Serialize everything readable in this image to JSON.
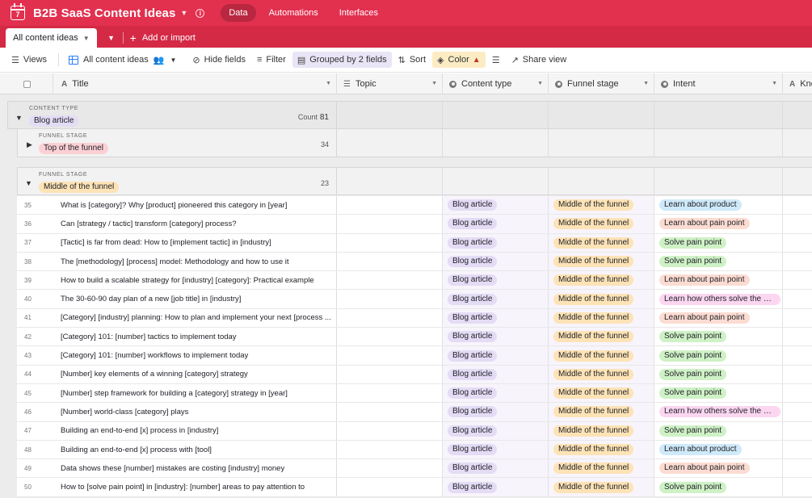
{
  "app": {
    "title": "B2B SaaS Content Ideas",
    "calendar_day": "7",
    "nav": [
      "Data",
      "Automations",
      "Interfaces"
    ],
    "accent": "#e2304f"
  },
  "tabs": {
    "active": "All content ideas",
    "add_import": "Add or import"
  },
  "toolbar": {
    "views": "Views",
    "view_name": "All content ideas",
    "hide_fields": "Hide fields",
    "filter": "Filter",
    "grouped": "Grouped by 2 fields",
    "sort": "Sort",
    "color": "Color",
    "share": "Share view"
  },
  "columns": [
    "Title",
    "Topic",
    "Content type",
    "Funnel stage",
    "Intent",
    "Kno"
  ],
  "groups": {
    "level1_label": "CONTENT TYPE",
    "level1_value": "Blog article",
    "level1_count_label": "Count",
    "level1_count": "81",
    "level2_label": "FUNNEL STAGE",
    "top_value": "Top of the funnel",
    "top_count": "34",
    "middle_value": "Middle of the funnel",
    "middle_count": "23"
  },
  "rows": [
    {
      "n": "35",
      "title": "What is [category]? Why [product] pioneered this category in [year]",
      "type": "Blog article",
      "stage": "Middle of the funnel",
      "intent": "Learn about product",
      "ik": "lprod"
    },
    {
      "n": "36",
      "title": "Can [strategy / tactic] transform [category] process?",
      "type": "Blog article",
      "stage": "Middle of the funnel",
      "intent": "Learn about pain point",
      "ik": "lpain"
    },
    {
      "n": "37",
      "title": "[Tactic] is far from dead: How to [implement tactic] in [industry]",
      "type": "Blog article",
      "stage": "Middle of the funnel",
      "intent": "Solve pain point",
      "ik": "solve"
    },
    {
      "n": "38",
      "title": "The [methodology] [process] model: Methodology and how to use it",
      "type": "Blog article",
      "stage": "Middle of the funnel",
      "intent": "Solve pain point",
      "ik": "solve"
    },
    {
      "n": "39",
      "title": "How to build a scalable strategy for [industry] [category]: Practical example",
      "type": "Blog article",
      "stage": "Middle of the funnel",
      "intent": "Learn about pain point",
      "ik": "lpain"
    },
    {
      "n": "40",
      "title": "The 30-60-90 day plan of a new [job title] in [industry]",
      "type": "Blog article",
      "stage": "Middle of the funnel",
      "intent": "Learn how others solve the pai...",
      "ik": "lothers"
    },
    {
      "n": "41",
      "title": "[Category] [industry] planning: How to plan and implement your next [process ...",
      "type": "Blog article",
      "stage": "Middle of the funnel",
      "intent": "Learn about pain point",
      "ik": "lpain"
    },
    {
      "n": "42",
      "title": "[Category] 101: [number] tactics to implement today",
      "type": "Blog article",
      "stage": "Middle of the funnel",
      "intent": "Solve pain point",
      "ik": "solve"
    },
    {
      "n": "43",
      "title": "[Category] 101: [number] workflows to implement today",
      "type": "Blog article",
      "stage": "Middle of the funnel",
      "intent": "Solve pain point",
      "ik": "solve"
    },
    {
      "n": "44",
      "title": "[Number] key elements of a winning [category] strategy",
      "type": "Blog article",
      "stage": "Middle of the funnel",
      "intent": "Solve pain point",
      "ik": "solve"
    },
    {
      "n": "45",
      "title": "[Number] step framework for building a [category] strategy in [year]",
      "type": "Blog article",
      "stage": "Middle of the funnel",
      "intent": "Solve pain point",
      "ik": "solve"
    },
    {
      "n": "46",
      "title": "[Number] world-class [category] plays",
      "type": "Blog article",
      "stage": "Middle of the funnel",
      "intent": "Learn how others solve the pai...",
      "ik": "lothers"
    },
    {
      "n": "47",
      "title": "Building an end-to-end [x] process in [industry]",
      "type": "Blog article",
      "stage": "Middle of the funnel",
      "intent": "Solve pain point",
      "ik": "solve"
    },
    {
      "n": "48",
      "title": "Building an end-to-end [x] process with [tool]",
      "type": "Blog article",
      "stage": "Middle of the funnel",
      "intent": "Learn about product",
      "ik": "lprod"
    },
    {
      "n": "49",
      "title": "Data shows these [number] mistakes are costing [industry] money",
      "type": "Blog article",
      "stage": "Middle of the funnel",
      "intent": "Learn about pain point",
      "ik": "lpain"
    },
    {
      "n": "50",
      "title": "How to [solve pain point] in [industry]: [number] areas to pay attention to",
      "type": "Blog article",
      "stage": "Middle of the funnel",
      "intent": "Solve pain point",
      "ik": "solve"
    }
  ]
}
